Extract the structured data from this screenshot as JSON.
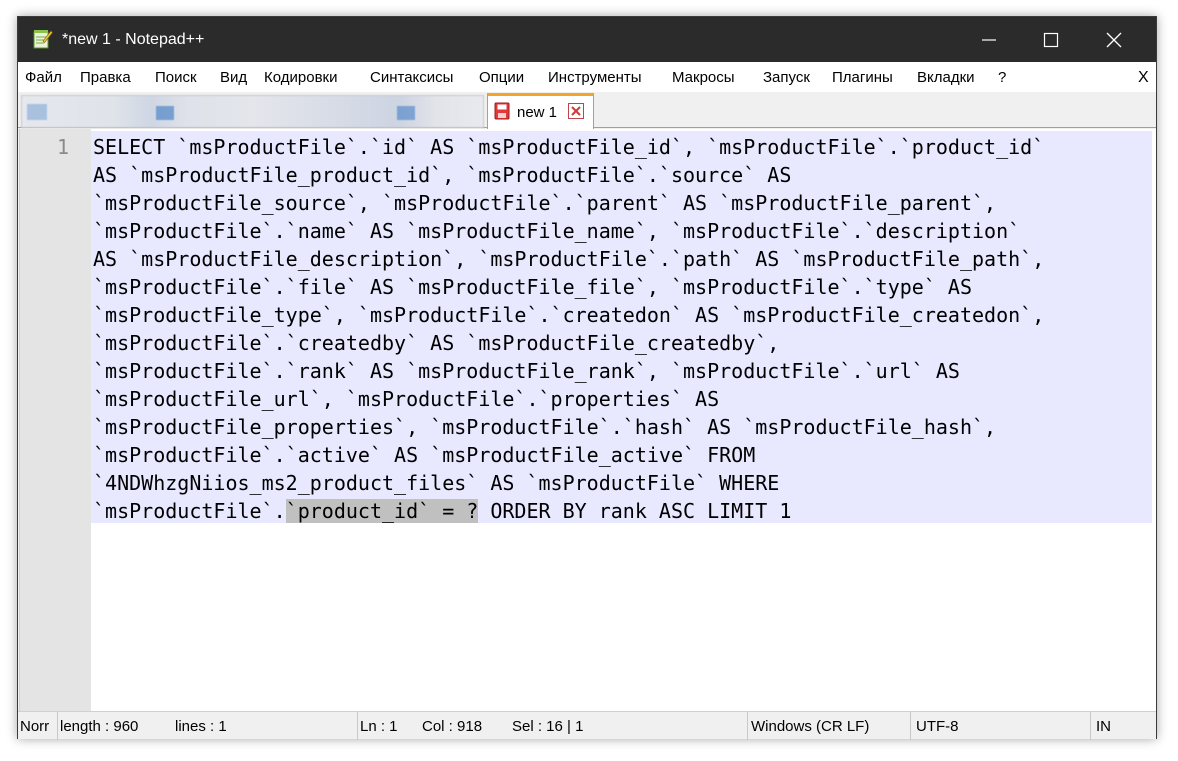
{
  "window": {
    "title": "*new 1 - Notepad++",
    "app_icon": "notepad-plus-plus-icon"
  },
  "menu": [
    "Файл",
    "Правка",
    "Поиск",
    "Вид",
    "Кодировки",
    "Синтаксисы",
    "Опции",
    "Инструменты",
    "Макросы",
    "Запуск",
    "Плагины",
    "Вкладки",
    "?"
  ],
  "menu_close": "X",
  "tabs": {
    "active": {
      "label": "new 1",
      "icon": "unsaved-file-icon",
      "close_icon": "close-tab-icon"
    }
  },
  "editor": {
    "line_number": "1",
    "lines": [
      "SELECT `msProductFile`.`id` AS `msProductFile_id`, `msProductFile`.`product_id`",
      "AS `msProductFile_product_id`, `msProductFile`.`source` AS",
      "`msProductFile_source`, `msProductFile`.`parent` AS `msProductFile_parent`,",
      "`msProductFile`.`name` AS `msProductFile_name`, `msProductFile`.`description`",
      "AS `msProductFile_description`, `msProductFile`.`path` AS `msProductFile_path`,",
      "`msProductFile`.`file` AS `msProductFile_file`, `msProductFile`.`type` AS",
      "`msProductFile_type`, `msProductFile`.`createdon` AS `msProductFile_createdon`,",
      "`msProductFile`.`createdby` AS `msProductFile_createdby`,",
      "`msProductFile`.`rank` AS `msProductFile_rank`, `msProductFile`.`url` AS",
      "`msProductFile_url`, `msProductFile`.`properties` AS",
      "`msProductFile_properties`, `msProductFile`.`hash` AS `msProductFile_hash`,",
      "`msProductFile`.`active` AS `msProductFile_active` FROM",
      "`4NDWhzgNiios_ms2_product_files` AS `msProductFile` WHERE"
    ],
    "last_line_prefix": "`msProductFile`.",
    "last_line_selected": "`product_id` = ?",
    "last_line_suffix": " ORDER BY rank ASC LIMIT 1"
  },
  "status": {
    "type": "Norr",
    "length": "length : 960",
    "lines": "lines : 1",
    "ln": "Ln : 1",
    "col": "Col : 918",
    "sel": "Sel : 16 | 1",
    "eol": "Windows (CR LF)",
    "encoding": "UTF-8",
    "mode": "IN"
  },
  "colors": {
    "titlebar": "#2b2b2b",
    "selection_background": "#e8e8ff",
    "active_tab_accent": "#f4a427",
    "highlight": "#c0c0c0"
  }
}
